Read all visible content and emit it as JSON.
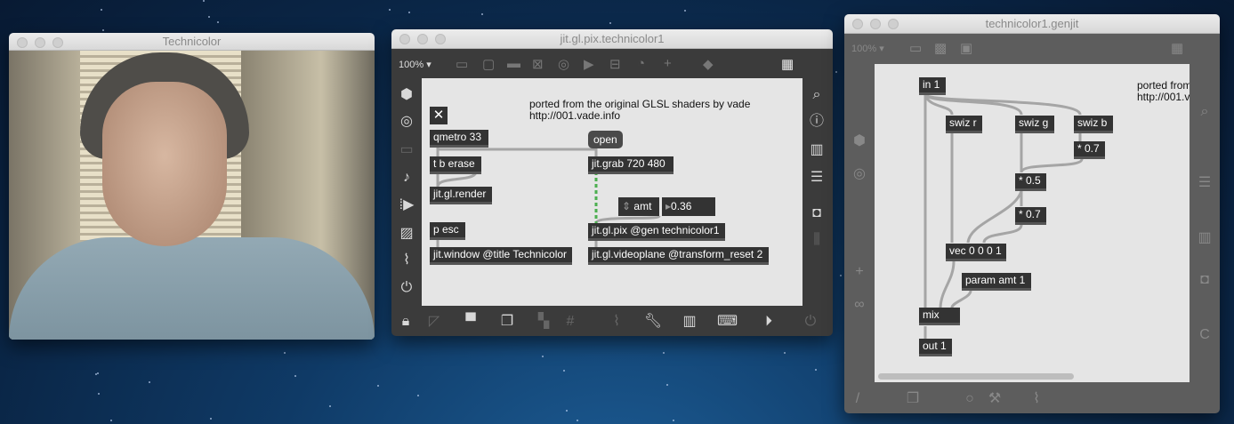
{
  "window1": {
    "title": "Technicolor"
  },
  "window2": {
    "title": "jit.gl.pix.technicolor1",
    "zoom": "100% ▾",
    "comment_line1": "ported from the original GLSL shaders by vade",
    "comment_line2": "http://001.vade.info",
    "objects": {
      "toggle": "✕",
      "qmetro": "qmetro 33",
      "open": "open",
      "tberase": "t b erase",
      "grab": "jit.grab 720 480",
      "render": "jit.gl.render",
      "amt_label": "amt",
      "amt_value": "0.36",
      "pesc": "p esc",
      "pix": "jit.gl.pix @gen technicolor1",
      "window": "jit.window @title Technicolor",
      "videoplane": "jit.gl.videoplane @transform_reset 2"
    }
  },
  "window3": {
    "title": "technicolor1.genjit",
    "zoom": "100% ▾",
    "comment_line1": "ported from",
    "comment_line2": "http://001.v",
    "objects": {
      "in1": "in 1",
      "swizr": "swiz r",
      "swizg": "swiz g",
      "swizb": "swiz b",
      "mul07a": "* 0.7",
      "mul05": "* 0.5",
      "mul07b": "* 0.7",
      "vec": "vec 0 0 0 1",
      "param": "param amt 1",
      "mix": "mix",
      "out1": "out 1"
    }
  },
  "colors": {
    "patch_bg": "#e5e5e5",
    "object_bg": "#333333",
    "toolbar": "#3b3b3b",
    "gen_toolbar": "#5d5d5d",
    "wire": "#a5a5a5",
    "signal_wire": "#4caf50"
  }
}
